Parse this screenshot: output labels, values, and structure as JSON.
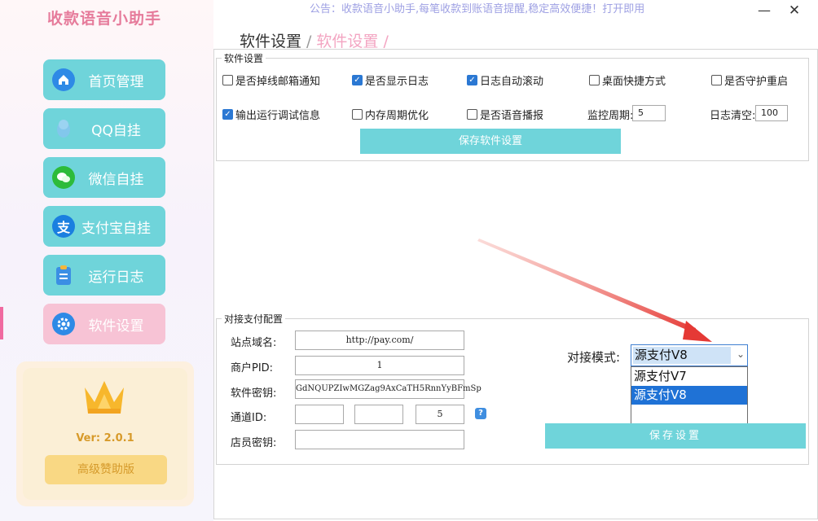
{
  "app": {
    "title": "收款语音小助手",
    "notice": "公告：收款语音小助手,每笔收款到账语音提醒,稳定高效便捷！打开即用"
  },
  "window": {
    "minimize": "—",
    "close": "✕"
  },
  "breadcrumb": {
    "level1": "软件设置",
    "separator": "/",
    "level2": "软件设置",
    "trailing": "/"
  },
  "sidebar": {
    "items": [
      {
        "label": "首页管理",
        "icon": "home-icon"
      },
      {
        "label": "QQ自挂",
        "icon": "qq-icon"
      },
      {
        "label": "微信自挂",
        "icon": "wechat-icon"
      },
      {
        "label": "支付宝自挂",
        "icon": "alipay-icon",
        "icon_text": "支"
      },
      {
        "label": "运行日志",
        "icon": "clipboard-icon"
      },
      {
        "label": "软件设置",
        "icon": "gear-icon",
        "active": true
      }
    ],
    "version": "Ver: 2.0.1",
    "upgrade_label": "高级赞助版"
  },
  "settings": {
    "legend": "软件设置",
    "checkboxes": [
      {
        "label": "是否掉线邮箱通知",
        "checked": false
      },
      {
        "label": "是否显示日志",
        "checked": true
      },
      {
        "label": "日志自动滚动",
        "checked": true
      },
      {
        "label": "桌面快捷方式",
        "checked": false
      },
      {
        "label": "是否守护重启",
        "checked": false
      },
      {
        "label": "输出运行调试信息",
        "checked": true
      },
      {
        "label": "内存周期优化",
        "checked": false
      },
      {
        "label": "是否语音播报",
        "checked": false
      }
    ],
    "monitor_period": {
      "label": "监控周期:",
      "value": "5"
    },
    "log_clear": {
      "label": "日志清空:",
      "value": "100"
    },
    "save_label": "保存软件设置"
  },
  "payment": {
    "legend": "对接支付配置",
    "site_domain": {
      "label": "站点域名:",
      "value": "http://pay.com/"
    },
    "merchant_pid": {
      "label": "商户PID:",
      "value": "1"
    },
    "secret_key": {
      "label": "软件密钥:",
      "value": "GdNQUPZIwMGZag9AxCaTH5RnnYyBFmSp"
    },
    "channel_id": {
      "label": "通道ID:",
      "values": [
        "",
        "",
        "5"
      ],
      "help": "?"
    },
    "clerk_key": {
      "label": "店员密钥:",
      "value": ""
    },
    "mode": {
      "label": "对接模式:",
      "selected": "源支付V8",
      "options": [
        "源支付V7",
        "源支付V8"
      ],
      "highlighted_index": 1
    },
    "save_label": "保存设置"
  },
  "colors": {
    "accent": "#6fd4da",
    "active_nav": "#f7c3d5",
    "title_pink": "#e67b9b",
    "annotation_arrow": "#e53935"
  }
}
